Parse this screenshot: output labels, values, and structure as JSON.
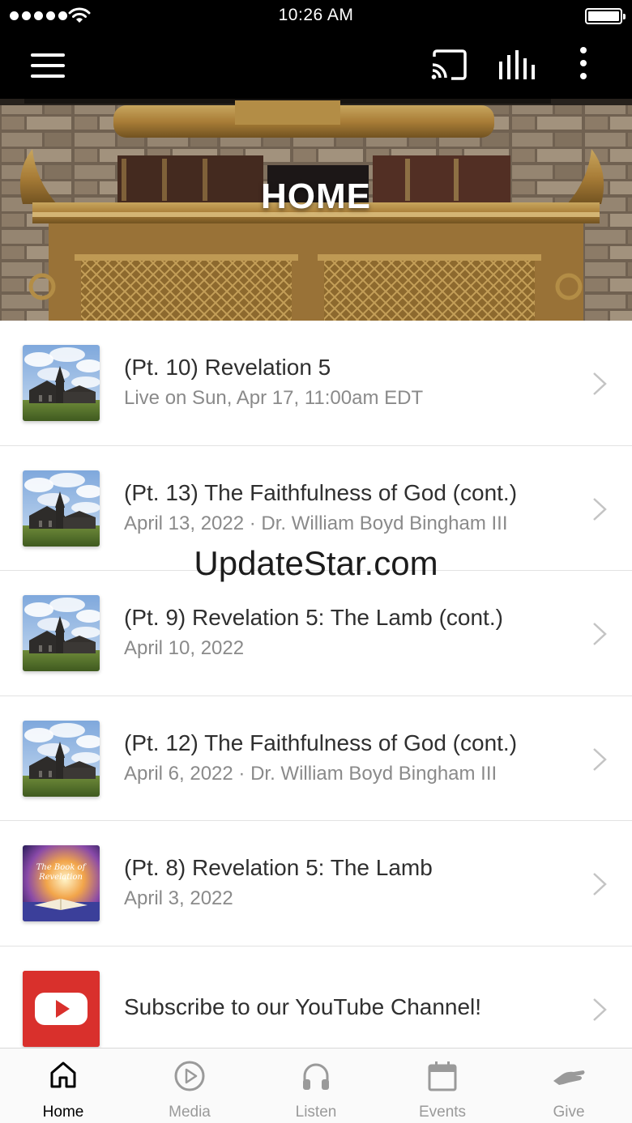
{
  "status_bar": {
    "time": "10:26 AM"
  },
  "header": {
    "icons": [
      "menu-icon",
      "cast-icon",
      "audio-bars-icon",
      "more-vertical-icon"
    ]
  },
  "hero": {
    "title": "HOME"
  },
  "watermark": "UpdateStar.com",
  "list": {
    "items": [
      {
        "title": "(Pt. 10) Revelation 5",
        "subtitle": "Live on Sun, Apr 17, 11:00am EDT",
        "thumbnail": "church-thumbnail"
      },
      {
        "title": "(Pt. 13) The Faithfulness of God (cont.)",
        "subtitle": "April 13, 2022 · Dr. William Boyd Bingham III",
        "thumbnail": "church-thumbnail"
      },
      {
        "title": "(Pt. 9) Revelation 5: The Lamb (cont.)",
        "subtitle": "April 10, 2022",
        "thumbnail": "church-thumbnail"
      },
      {
        "title": "(Pt. 12) The Faithfulness of God (cont.)",
        "subtitle": "April 6, 2022 · Dr. William Boyd Bingham III",
        "thumbnail": "church-thumbnail"
      },
      {
        "title": "(Pt. 8) Revelation 5: The Lamb",
        "subtitle": "April 3, 2022",
        "thumbnail": "book-of-revelation-thumbnail",
        "thumbnail_text": [
          "The Book of",
          "Revelation"
        ]
      },
      {
        "title": "Subscribe to our YouTube Channel!",
        "thumbnail": "youtube-icon"
      }
    ]
  },
  "tabs": [
    {
      "label": "Home",
      "icon": "home-icon",
      "active": true
    },
    {
      "label": "Media",
      "icon": "play-circle-icon",
      "active": false
    },
    {
      "label": "Listen",
      "icon": "headphones-icon",
      "active": false
    },
    {
      "label": "Events",
      "icon": "calendar-icon",
      "active": false
    },
    {
      "label": "Give",
      "icon": "give-hand-icon",
      "active": false
    }
  ],
  "colors": {
    "bar_background": "#000000",
    "youtube_red": "#e53935",
    "active_tab": "#000000",
    "inactive_tab": "#9a9a9a"
  }
}
